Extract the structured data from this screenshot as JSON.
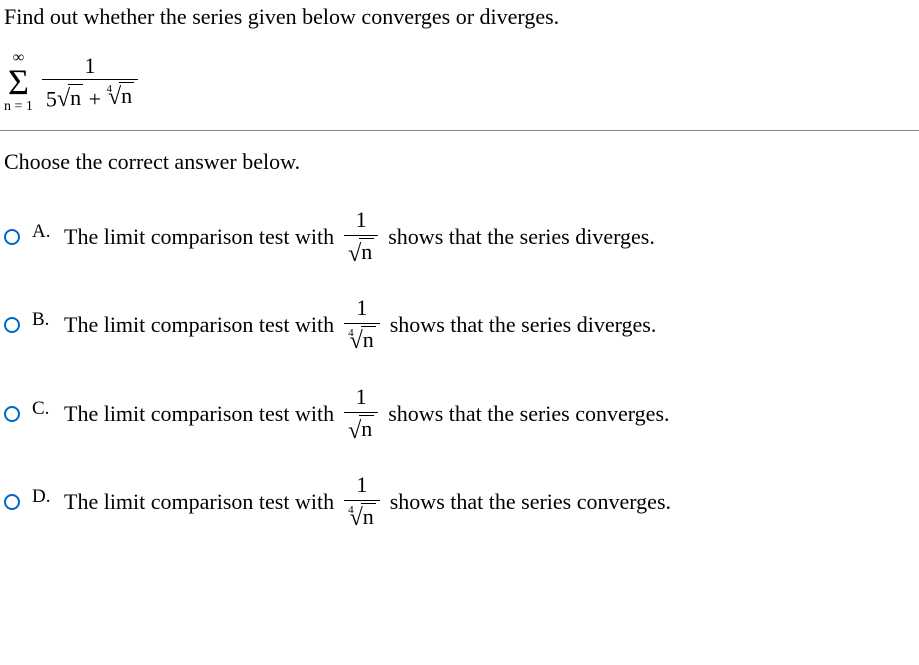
{
  "question": "Find out whether the series given below converges or diverges.",
  "series": {
    "upper": "∞",
    "lower": "n = 1",
    "numerator": "1",
    "coeff": "5",
    "root2_body": "n",
    "plus": " + ",
    "root4_index": "4",
    "root4_body": "n"
  },
  "choose": "Choose the correct answer below.",
  "options": {
    "a": {
      "label": "A.",
      "prefix": "The limit comparison test with",
      "frac_num": "1",
      "frac_den_body": "n",
      "suffix": "shows that the series diverges."
    },
    "b": {
      "label": "B.",
      "prefix": "The limit comparison test with",
      "frac_num": "1",
      "frac_den_index": "4",
      "frac_den_body": "n",
      "suffix": "shows that the series diverges."
    },
    "c": {
      "label": "C.",
      "prefix": "The limit comparison test with",
      "frac_num": "1",
      "frac_den_body": "n",
      "suffix": "shows that the series converges."
    },
    "d": {
      "label": "D.",
      "prefix": "The limit comparison test with",
      "frac_num": "1",
      "frac_den_index": "4",
      "frac_den_body": "n",
      "suffix": "shows that the series converges."
    }
  }
}
